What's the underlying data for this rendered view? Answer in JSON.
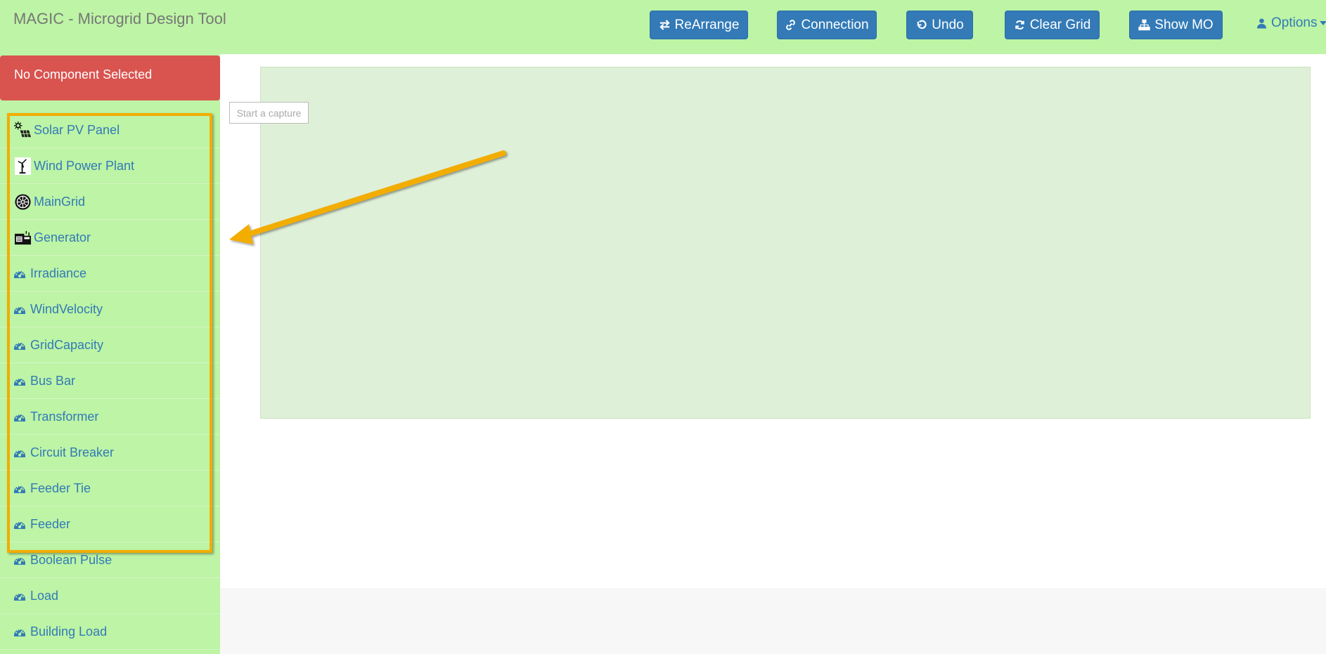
{
  "header": {
    "title": "MAGIC - Microgrid Design Tool",
    "buttons": {
      "rearrange": "ReArrange",
      "connection": "Connection",
      "undo": "Undo",
      "clear_grid": "Clear Grid",
      "show_mo": "Show MO"
    },
    "options": "Options"
  },
  "sidebar": {
    "alert": "No Component Selected",
    "items": [
      {
        "label": "Solar PV Panel",
        "icon": "solar-panel-icon"
      },
      {
        "label": "Wind Power Plant",
        "icon": "wind-turbine-icon"
      },
      {
        "label": "MainGrid",
        "icon": "main-grid-icon"
      },
      {
        "label": "Generator",
        "icon": "generator-icon"
      },
      {
        "label": "Irradiance",
        "icon": "dashboard-icon"
      },
      {
        "label": "WindVelocity",
        "icon": "dashboard-icon"
      },
      {
        "label": "GridCapacity",
        "icon": "dashboard-icon"
      },
      {
        "label": "Bus Bar",
        "icon": "dashboard-icon"
      },
      {
        "label": "Transformer",
        "icon": "dashboard-icon"
      },
      {
        "label": "Circuit Breaker",
        "icon": "dashboard-icon"
      },
      {
        "label": "Feeder Tie",
        "icon": "dashboard-icon"
      },
      {
        "label": "Feeder",
        "icon": "dashboard-icon"
      },
      {
        "label": "Boolean Pulse",
        "icon": "dashboard-icon"
      },
      {
        "label": "Load",
        "icon": "dashboard-icon"
      },
      {
        "label": "Building Load",
        "icon": "dashboard-icon"
      }
    ]
  },
  "workspace": {
    "capture_button": "Start a capture"
  },
  "colors": {
    "header_bg": "#bdf4a5",
    "primary": "#337ab7",
    "danger": "#d9534f",
    "grid_bg": "#dff0d8",
    "highlight": "#f2ad00"
  }
}
